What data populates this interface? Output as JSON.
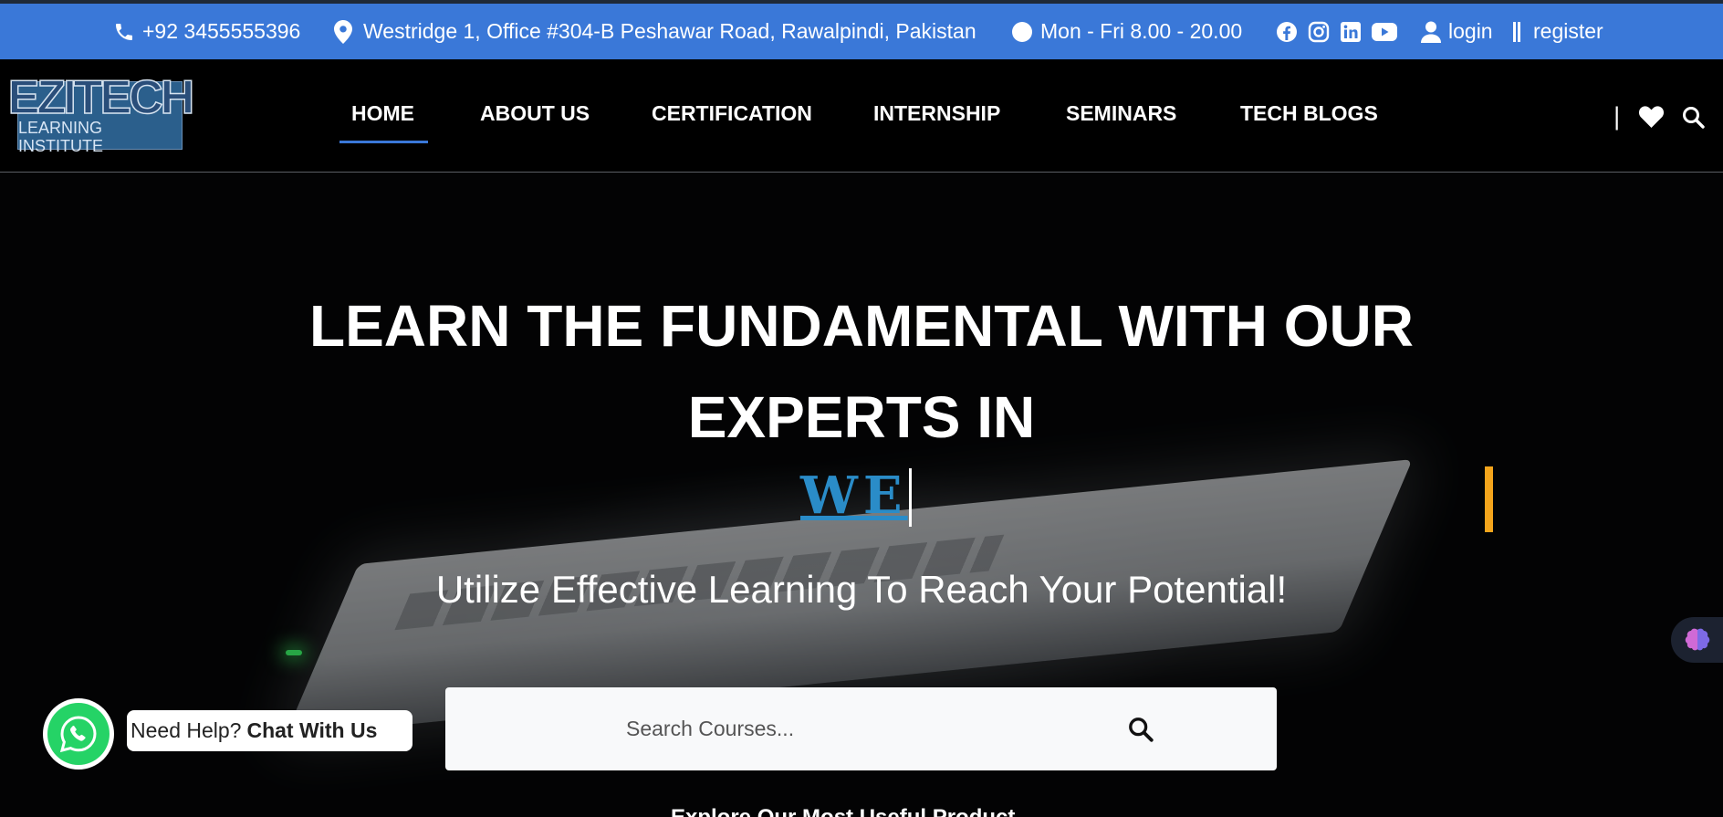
{
  "topbar": {
    "phone": "+92 3455555396",
    "address": "Westridge 1, Office #304-B Peshawar Road, Rawalpindi, Pakistan",
    "hours": "Mon - Fri 8.00 - 20.00",
    "social_icons": [
      "facebook-icon",
      "instagram-icon",
      "linkedin-icon",
      "youtube-icon"
    ],
    "login_label": "login",
    "register_label": "register"
  },
  "header": {
    "logo_main": "EZITECH",
    "logo_sub": "LEARNING INSTITUTE",
    "nav": [
      "HOME",
      "ABOUT US",
      "CERTIFICATION",
      "INTERNSHIP",
      "SEMINARS",
      "TECH BLOGS"
    ],
    "active_nav": "HOME",
    "divider": "|"
  },
  "hero": {
    "title_line1": "LEARN THE FUNDAMENTAL WITH OUR",
    "title_line2": "EXPERTS IN",
    "typed_text": "WE",
    "subtitle": "Utilize Effective Learning To Reach Your Potential!",
    "search_placeholder": "Search Courses...",
    "bottom_text": "Explore Our Most Useful Product"
  },
  "whatsapp": {
    "prefix": "Need Help?",
    "cta": "Chat With Us"
  },
  "colors": {
    "topbar": "#3a78d8",
    "accent_underline": "#3a78d8",
    "typed_text": "#2a8cc8",
    "orange_bar": "#f4a51c",
    "whatsapp": "#25d366"
  }
}
